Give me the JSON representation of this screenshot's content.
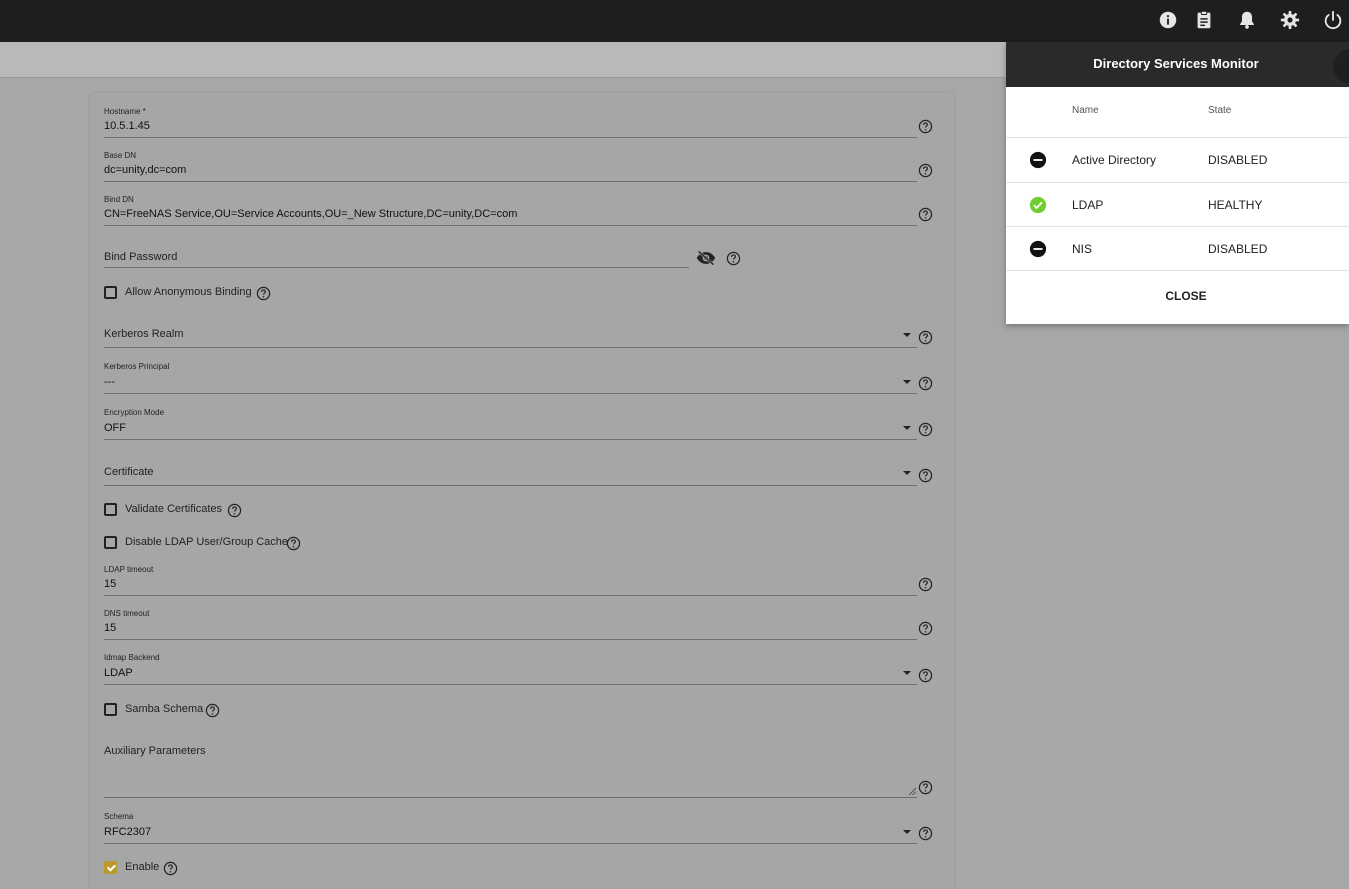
{
  "topbar": {
    "icons": [
      "info-icon",
      "clipboard-icon",
      "bell-icon",
      "gear-icon",
      "power-icon"
    ]
  },
  "form": {
    "hostname": {
      "label": "Hostname *",
      "value": "10.5.1.45"
    },
    "base_dn": {
      "label": "Base DN",
      "value": "dc=unity,dc=com"
    },
    "bind_dn": {
      "label": "Bind DN",
      "value": "CN=FreeNAS Service,OU=Service Accounts,OU=_New Structure,DC=unity,DC=com"
    },
    "bind_password": {
      "placeholder": "Bind Password"
    },
    "allow_anonymous": {
      "label": "Allow Anonymous Binding",
      "checked": false
    },
    "kerberos_realm": {
      "placeholder": "Kerberos Realm"
    },
    "kerberos_principal": {
      "label": "Kerberos Principal",
      "value": "---"
    },
    "encryption_mode": {
      "label": "Encryption Mode",
      "value": "OFF"
    },
    "certificate": {
      "placeholder": "Certificate"
    },
    "validate_certs": {
      "label": "Validate Certificates",
      "checked": false
    },
    "disable_cache": {
      "label": "Disable LDAP User/Group Cache",
      "checked": false
    },
    "ldap_timeout": {
      "label": "LDAP timeout",
      "value": "15"
    },
    "dns_timeout": {
      "label": "DNS timeout",
      "value": "15"
    },
    "idmap_backend": {
      "label": "Idmap Backend",
      "value": "LDAP"
    },
    "samba_schema": {
      "label": "Samba Schema",
      "checked": false
    },
    "aux_params": {
      "placeholder": "Auxiliary Parameters"
    },
    "schema": {
      "label": "Schema",
      "value": "RFC2307"
    },
    "enable": {
      "label": "Enable",
      "checked": true
    }
  },
  "monitor": {
    "title": "Directory Services Monitor",
    "col_name": "Name",
    "col_state": "State",
    "rows": [
      {
        "name": "Active Directory",
        "state": "DISABLED",
        "status_icon": "minus-circle-icon"
      },
      {
        "name": "LDAP",
        "state": "HEALTHY",
        "status_icon": "check-circle-icon"
      },
      {
        "name": "NIS",
        "state": "DISABLED",
        "status_icon": "minus-circle-icon"
      }
    ],
    "close_label": "CLOSE"
  },
  "colors": {
    "topbar": "#1e1e1e",
    "healthy": "#6fcf31",
    "checkbox_checked": "#b89b2c"
  }
}
